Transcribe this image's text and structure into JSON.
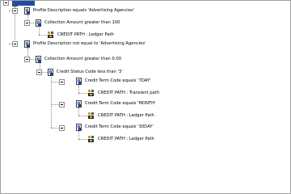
{
  "tree": {
    "n1": "Profile Description equals 'Advertising Agencies'",
    "n1a": "Collection Amount greater than 100",
    "n1a1": "CREDIT PATH : Ledger Path",
    "n2": "Profile Description not equal to 'Advertising Agencies'",
    "n2a": "Collection Amount greater than 0.00",
    "n2a1": "Credit Status Code less than '3'",
    "n2a1a": "Credit Term Code equals '7DAY'",
    "n2a1a1": "CREDIT PATH : Transient path",
    "n2a1b": "Credit Term Code equals 'MONTH'",
    "n2a1b1": "CREDIT PATH : Ledger Path",
    "n2a1c": "Credit Term Code equals '30DAY'",
    "n2a1c1": "CREDIT PATH : Ledger Path"
  }
}
